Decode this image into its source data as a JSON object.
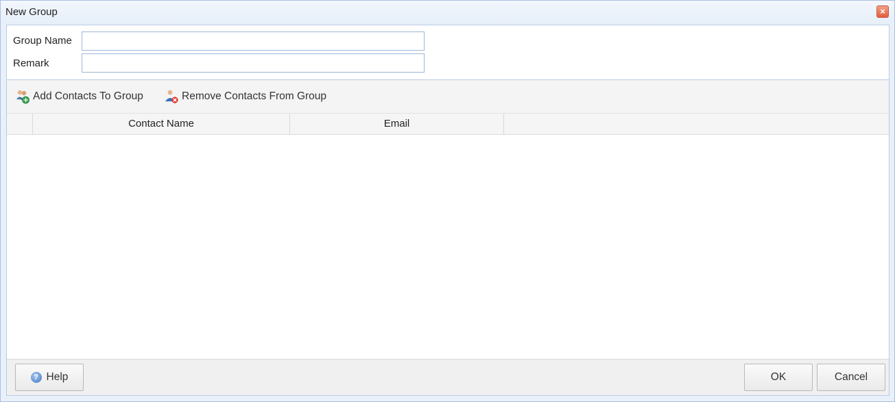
{
  "window": {
    "title": "New Group",
    "close_label": "×"
  },
  "form": {
    "group_name_label": "Group Name",
    "group_name_value": "",
    "remark_label": "Remark",
    "remark_value": ""
  },
  "toolbar": {
    "add_label": "Add Contacts To Group",
    "remove_label": "Remove Contacts From Group"
  },
  "grid": {
    "columns": [
      "Contact Name",
      "Email"
    ],
    "rows": []
  },
  "footer": {
    "help_label": "Help",
    "help_icon_glyph": "?",
    "ok_label": "OK",
    "cancel_label": "Cancel"
  },
  "colors": {
    "title_bg": "#e6eef9",
    "close_button": "#e0603f",
    "border": "#a9c0e1"
  },
  "icons": {
    "add": "add-contacts-icon",
    "remove": "remove-contacts-icon",
    "help": "help-icon",
    "close": "close-icon"
  }
}
